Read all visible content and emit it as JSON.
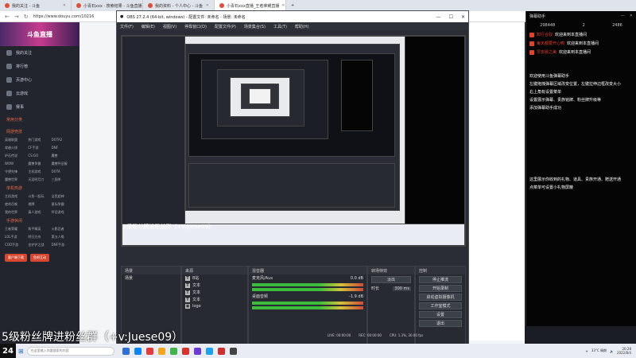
{
  "browser": {
    "tabs": [
      {
        "label": "我的关注 - 斗鱼",
        "active": false
      },
      {
        "label": "小青石xxx · 搜索结果 - 斗鱼直播",
        "active": false
      },
      {
        "label": "我的资料 - 个人中心 - 斗鱼",
        "active": false
      },
      {
        "label": "小青石xxx直播_王者荣耀直播",
        "active": true
      }
    ],
    "url": "https://www.douyu.com/10216",
    "new_tab": "+"
  },
  "site": {
    "banner": "斗鱼直播",
    "nav": [
      {
        "label": "我的关注",
        "icon": "heart-icon"
      },
      {
        "label": "排行榜",
        "icon": "trophy-icon"
      },
      {
        "label": "页游中心",
        "icon": "gamepad-icon"
      },
      {
        "label": "云游戏",
        "icon": "cloud-icon"
      },
      {
        "label": "赛事",
        "icon": "cup-icon"
      }
    ],
    "groups": [
      {
        "title": "常用分类",
        "items": []
      },
      {
        "title": "网游竞技",
        "items": [
          "英雄联盟",
          "热门游戏",
          "DOTA2",
          "穿越火线",
          "CF手游",
          "DNF",
          "炉石传说",
          "CS:GO",
          "魔兽",
          "WOW",
          "魔兽争霸",
          "魔兽怀旧服",
          "守望先锋",
          "主机游戏",
          "DOTA",
          "魔兽世界",
          "天涯明月刀",
          "三国杀"
        ]
      },
      {
        "title": "单机热游",
        "items": [
          "主机游戏",
          "斗鱼一起玩",
          "全民超神",
          "使命召唤",
          "棋牌",
          "星际争霸",
          "我的世界",
          "真人游戏",
          "怀旧游戏"
        ]
      },
      {
        "title": "手游休闲",
        "items": [
          "王者荣耀",
          "和平精英",
          "火影忍者",
          "LOL手游",
          "明日方舟",
          "第五人格",
          "COD手游",
          "金铲铲之战",
          "DNF手游"
        ]
      }
    ],
    "buttons": [
      "客户端下载",
      "鱼吧互动"
    ]
  },
  "obs": {
    "title": "OBS 27.2.4 (64-bit, windows) - 配置文件: 未命名 - 场景: 未命名",
    "menu": [
      "文件(F)",
      "编辑(E)",
      "视图(V)",
      "停靠窗口(D)",
      "配置文件(P)",
      "场景集合(S)",
      "工具(T)",
      "帮助(H)"
    ],
    "inner_subtitle": "5级粉丝牌进粉丝群（+v:Juese09）",
    "panel_scenes": "场景",
    "panel_sources": "来源",
    "panel_mixer": "混音器",
    "panel_transitions": "转场特效",
    "panel_controls": "控制",
    "scenes": [
      "场景"
    ],
    "sources": [
      "B站",
      "文本",
      "文本",
      "文本",
      "logo"
    ],
    "mixer": [
      {
        "label": "桌面音频",
        "db": "-1.9 dB"
      },
      {
        "label": "麦克风/Aux",
        "db": "0.0 dB"
      }
    ],
    "transition": {
      "type": "淡出",
      "duration_label": "时长",
      "duration": "300 ms"
    },
    "controls": [
      "停止推流",
      "开始录制",
      "启动虚拟摄像机",
      "工作室模式",
      "设置",
      "退出"
    ],
    "status": {
      "live": "LIVE: 00:00:00",
      "rec": "REC: 00:00:00",
      "cpu": "CPU: 1.3%, 30.00 fps"
    },
    "window_controls": [
      "—",
      "☐",
      "✕"
    ]
  },
  "chat": {
    "title": "弹幕助手",
    "stats": [
      "298448",
      "2",
      "2486"
    ],
    "messages": [
      {
        "name": "知行合驭",
        "text": "欢迎来到本直播间"
      },
      {
        "name": "每天都要开心鸭",
        "text": "欢迎来到本直播间"
      },
      {
        "name": "早安晨之美",
        "text": "欢迎来到本直播间"
      }
    ],
    "hints": [
      "欢迎使用斗鱼弹幕助手",
      "左键拖拽弹幕区域改变位置，左键拉伸边框改变大小",
      "右上角有设置菜单",
      "设置展示弹幕、贵族铭牌、粉丝牌升级等",
      "添加弹幕助手成功",
      "这里展示你收到的礼物、道具、贵族开通、赠送开通",
      "点菜单可设置小礼物屏蔽"
    ],
    "window_controls": [
      "—",
      "✕"
    ]
  },
  "bottom_subtitle": "5级粉丝牌进粉丝群（+v:Juese09）",
  "taskbar": {
    "ai_label": "24",
    "search_placeholder": "在这里输入你要搜索的内容",
    "weather": "33°C 晴朗",
    "time": "20:28",
    "date": "2022/8/4",
    "app_colors": [
      "#2f6fd6",
      "#0a84ff",
      "#e23b3b",
      "#f2a71b",
      "#3fb44a",
      "#d9342b",
      "#6b3ad6",
      "#1da1f2",
      "#cf2e2e",
      "#444444"
    ]
  }
}
